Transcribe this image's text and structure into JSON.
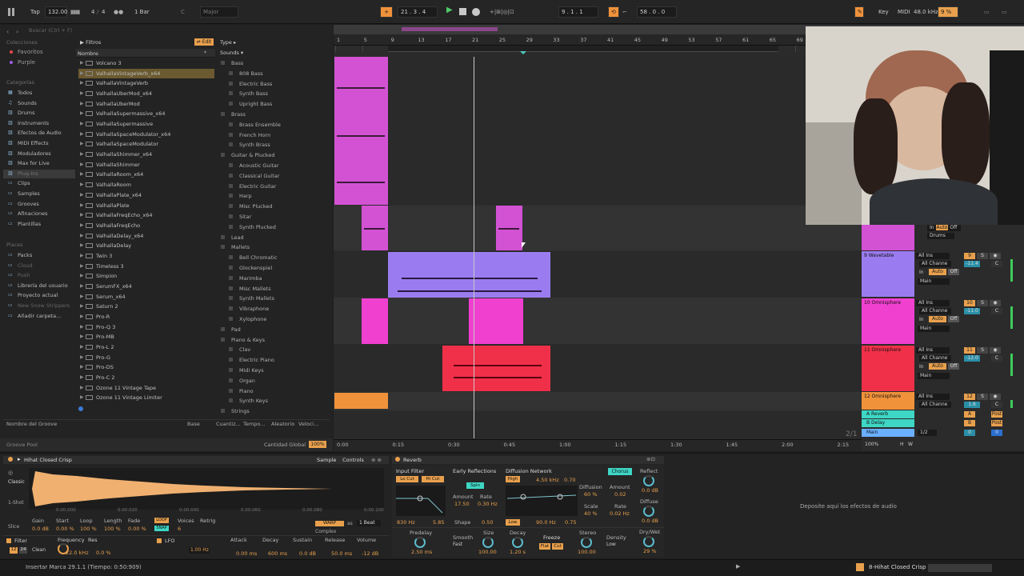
{
  "transport": {
    "tap": "Tap",
    "tempo": "132.00",
    "sig_num": "4",
    "sig_den": "4",
    "quantize": "1 Bar",
    "key": "C",
    "scale": "Major",
    "position": "21 . 3 . 4",
    "loop_start": "9 . 1 . 1",
    "loop_len": "58 . 0 . 0",
    "key_label": "Key",
    "midi_label": "MIDI",
    "sample_rate": "48.0 kHz",
    "cpu": "9 %"
  },
  "browser": {
    "search_placeholder": "Buscar (Ctrl + F)",
    "collections_title": "Colecciones",
    "collections": [
      "Favoritos",
      "Purple"
    ],
    "collection_colors": [
      "#e84a4a",
      "#9b5de5"
    ],
    "categories_title": "Categorías",
    "categories": [
      "Todos",
      "Sounds",
      "Drums",
      "Instruments",
      "Efectos de Audio",
      "MIDI Effects",
      "Moduladores",
      "Max for Live",
      "Plug-Ins",
      "Clips",
      "Samples",
      "Grooves",
      "Afinaciones",
      "Plantillas"
    ],
    "places_title": "Places",
    "places": [
      "Packs",
      "Cloud",
      "Push",
      "Librería del usuario",
      "Proyecto actual",
      "New Snow Strippers",
      "Añadir carpeta..."
    ],
    "filtros": "Filtros",
    "edit": "Edit",
    "name_header": "Nombre",
    "names": [
      "Volcano 3",
      "ValhallaVintageVerb_x64",
      "ValhallaVintageVerb",
      "ValhallaUberMod_x64",
      "ValhallaUberMod",
      "ValhallaSupermassive_x64",
      "ValhallaSupermassive",
      "ValhallaSpaceModulator_x64",
      "ValhallaSpaceModulator",
      "ValhallaShimmer_x64",
      "ValhallaShimmer",
      "ValhallaRoom_x64",
      "ValhallaRoom",
      "ValhallaPlate_x64",
      "ValhallaPlate",
      "ValhallaFreqEcho_x64",
      "ValhallaFreqEcho",
      "ValhallaDelay_x64",
      "ValhallaDelay",
      "Twin 3",
      "Timeless 3",
      "Simpion",
      "SerumFX_x64",
      "Serum_x64",
      "Saturn 2",
      "Pro-R",
      "Pro-Q 3",
      "Pro-MB",
      "Pro-L 2",
      "Pro-G",
      "Pro-DS",
      "Pro-C 2",
      "Ozone 11 Vintage Tape",
      "Ozone 11 Vintage Limiter"
    ],
    "type_header": "Type",
    "sounds_label": "Sounds",
    "types": [
      {
        "label": "Bass",
        "head": true
      },
      {
        "label": "808 Bass"
      },
      {
        "label": "Electric Bass"
      },
      {
        "label": "Synth Bass"
      },
      {
        "label": "Upright Bass"
      },
      {
        "label": "Brass",
        "head": true
      },
      {
        "label": "Brass Ensemble"
      },
      {
        "label": "French Horn"
      },
      {
        "label": "Synth Brass"
      },
      {
        "label": "Guitar & Plucked",
        "head": true
      },
      {
        "label": "Acoustic Guitar"
      },
      {
        "label": "Classical Guitar"
      },
      {
        "label": "Electric Guitar"
      },
      {
        "label": "Harp"
      },
      {
        "label": "Misc Plucked"
      },
      {
        "label": "Sitar"
      },
      {
        "label": "Synth Plucked"
      },
      {
        "label": "Lead",
        "head": true
      },
      {
        "label": "Mallets",
        "head": true
      },
      {
        "label": "Bell Chromatic"
      },
      {
        "label": "Glockenspiel"
      },
      {
        "label": "Marimba"
      },
      {
        "label": "Misc Mallets"
      },
      {
        "label": "Synth Mallets"
      },
      {
        "label": "Vibraphone"
      },
      {
        "label": "Xylophone"
      },
      {
        "label": "Pad",
        "head": true
      },
      {
        "label": "Piano & Keys",
        "head": true
      },
      {
        "label": "Clav"
      },
      {
        "label": "Electric Piano"
      },
      {
        "label": "Midi Keys"
      },
      {
        "label": "Organ"
      },
      {
        "label": "Piano"
      },
      {
        "label": "Synth Keys"
      },
      {
        "label": "Strings",
        "head": true
      }
    ],
    "groove_cols": [
      "Nombre del Groove",
      "Base",
      "Cuantiz...",
      "Tempo...",
      "Aleatorio",
      "Veloci..."
    ],
    "groove_pool": "Groove Pool",
    "global_amount_label": "Cantidad Global",
    "global_amount": "100%"
  },
  "ruler": {
    "bars": [
      "1",
      "5",
      "9",
      "13",
      "17",
      "21",
      "25",
      "29",
      "33",
      "37",
      "41",
      "45",
      "49",
      "53",
      "57",
      "61",
      "65",
      "69"
    ],
    "times": [
      "0:00",
      "0:15",
      "0:30",
      "0:45",
      "1:00",
      "1:15",
      "1:30",
      "1:45",
      "2:00",
      "2:15"
    ]
  },
  "tracks": [
    {
      "name": "Drums",
      "color": "#e060e0",
      "input": "In",
      "auto": "Auto",
      "off": "Off"
    },
    {
      "name": "9 Wavetable",
      "color": "#9b7cf0",
      "ins": "All Ins",
      "channel": "All Channe",
      "num": "9",
      "vol": "-11.4",
      "pan": "C",
      "monitor_in": "In",
      "auto": "Auto",
      "off": "Off",
      "out": "Main"
    },
    {
      "name": "10 Omnisphere",
      "color": "#f040d0",
      "ins": "All Ins",
      "channel": "All Channe",
      "num": "10",
      "vol": "-11.0",
      "pan": "C",
      "monitor_in": "In",
      "auto": "Auto",
      "off": "Off",
      "out": "Main"
    },
    {
      "name": "11 Omnisphere",
      "color": "#f03048",
      "ins": "All Ins",
      "channel": "All Channe",
      "num": "11",
      "vol": "-12.0",
      "pan": "C",
      "monitor_in": "In",
      "auto": "Auto",
      "off": "Off",
      "out": "Main"
    },
    {
      "name": "12 Omnisphere",
      "color": "#f0923a",
      "ins": "All Ins",
      "channel": "All Channe",
      "num": "12",
      "vol": "1.6",
      "pan": "C"
    }
  ],
  "returns": [
    {
      "name": "A Reverb",
      "letter": "A",
      "post": "Post",
      "color": "#3ed6c4"
    },
    {
      "name": "B Delay",
      "letter": "B",
      "post": "Post",
      "color": "#3ed6c4"
    },
    {
      "name": "Main",
      "out": "1/2",
      "vol": "0",
      "pan": "0",
      "color": "#6ab0ff"
    }
  ],
  "zoom": {
    "fraction": "2/1",
    "percent": "100%",
    "h": "H",
    "w": "W"
  },
  "sampler": {
    "title": "Hihat Closed Crisp",
    "tab_sample": "Sample",
    "tab_controls": "Controls",
    "mode": "Classic",
    "oneshot": "1-Shot",
    "slice": "Slice",
    "times": [
      "0:00:000",
      "0:00:020",
      "0:00:040",
      "0:00:060",
      "0:00:080",
      "0:00:100"
    ],
    "params": [
      "Gain",
      "Start",
      "Loop",
      "Length",
      "Fade",
      "Voices",
      "Retrig"
    ],
    "values": [
      "0.0 dB",
      "0.00 %",
      "100 %",
      "100 %",
      "0.00 %",
      "6"
    ],
    "warp": "WARP",
    "as": "as",
    "beats": "1 Beat",
    "complex": "Complex",
    "loop_label": "LOOP",
    "snap": "SNAP",
    "filter": "Filter",
    "filter_type": "12",
    "filter_mode": "24",
    "clean": "Clean",
    "frequency": "Frequency",
    "freq_val": "22.0 kHz",
    "res": "Res",
    "res_val": "0.0 %",
    "lfo": "LFO",
    "lfo_hz": "1.00 Hz",
    "attack": "Attack",
    "attack_val": "0.00 ms",
    "decay": "Decay",
    "decay_val": "600 ms",
    "sustain": "Sustain",
    "sustain_val": "0.0 dB",
    "release": "Release",
    "release_val": "50.0 ms",
    "volume": "Volume",
    "volume_val": "-12 dB"
  },
  "reverb": {
    "title": "Reverb",
    "input_filter": "Input Filter",
    "lo_cut": "Lo Cut",
    "hi_cut": "Hi Cut",
    "low_freq": "830 Hz",
    "high_freq": "5.85",
    "early": "Early Reflections",
    "spin": "Spin",
    "amount": "Amount",
    "rate": "Rate",
    "er_amount": "17.50",
    "er_rate": "0.30 Hz",
    "shape": "Shape",
    "shape_val": "0.50",
    "diffusion": "Diffusion Network",
    "high": "High",
    "high_freq_val": "4.50 kHz",
    "high_val": "0.70",
    "low": "Low",
    "low_freq_val": "90.0 Hz",
    "low_val": "0.75",
    "diff_label": "Diffusion",
    "diff_val": "60 %",
    "scale": "Scale",
    "scale_val": "40 %",
    "chorus": "Chorus",
    "ch_amount": "0.02",
    "ch_rate": "0.02 Hz",
    "reflect": "Reflect",
    "reflect_val": "0.0 dB",
    "diffuse": "Diffuse",
    "diffuse_val": "0.0 dB",
    "predelay": "Predelay",
    "predelay_val": "2.50 ms",
    "smooth": "Smooth",
    "smooth_val": "Fast",
    "size": "Size",
    "size_val": "100.00",
    "decay": "Decay",
    "decay_val": "1.20 s",
    "freeze": "Freeze",
    "flat": "Flat",
    "cut": "Cut",
    "stereo": "Stereo",
    "stereo_val": "100.00",
    "density": "Density",
    "density_val": "Low",
    "drywet": "Dry/Wet",
    "drywet_val": "29 %"
  },
  "drop_text": "Deposite aquí los efectos de audio",
  "status": {
    "message": "Insertar Marca 29.1.1 (Tiempo: 0:50:909)",
    "track": "8-Hihat Closed Crisp"
  }
}
